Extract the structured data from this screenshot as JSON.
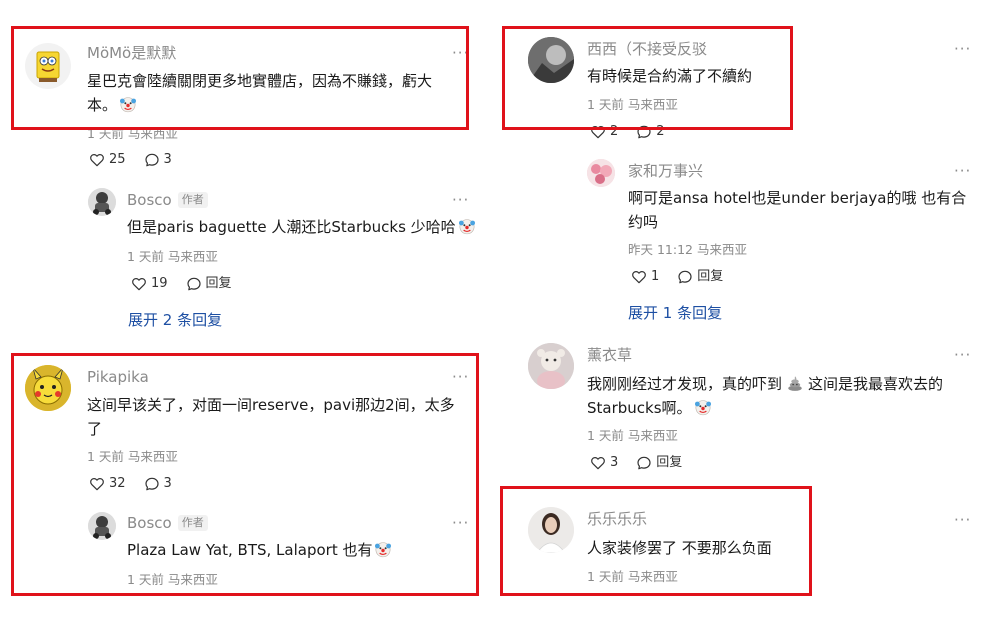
{
  "ui": {
    "more": "···",
    "author_tag": "作者",
    "highlight_color": "#e0121a",
    "link_color": "#1d4fa3"
  },
  "c1": {
    "user": "MöMö是默默",
    "text": "星巴克會陸續關閉更多地實體店，因為不賺錢，虧大本。",
    "emoji": "clown-face",
    "meta": "1 天前 马来西亚",
    "likes": "25",
    "comments": "3"
  },
  "r1": {
    "user": "Bosco",
    "text": "但是paris baguette 人潮还比Starbucks 少哈哈",
    "emoji": "clown-face",
    "meta": "1 天前 马来西亚",
    "likes": "19",
    "reply": "回复"
  },
  "expand1": "展开 2 条回复",
  "c2": {
    "user": "Pikapika",
    "text": "这间早该关了，对面一间reserve，pavi那边2间，太多了",
    "meta": "1 天前 马来西亚",
    "likes": "32",
    "comments": "3"
  },
  "r2": {
    "user": "Bosco",
    "text": "Plaza Law Yat, BTS, Lalaport 也有",
    "emoji": "clown-face",
    "meta": "1 天前 马来西亚"
  },
  "c3": {
    "user": "西西（不接受反驳",
    "text": "有時候是合約滿了不續約",
    "meta": "1 天前 马来西亚",
    "likes": "2",
    "comments": "2"
  },
  "r3": {
    "user": "家和万事兴",
    "text": "啊可是ansa hotel也是under berjaya的哦 也有合约吗",
    "meta": "昨天 11:12 马来西亚",
    "likes": "1",
    "reply": "回复"
  },
  "expand2": "展开 1 条回复",
  "c4": {
    "user": "薰衣草",
    "text_a": "我刚刚经过才发现，真的吓到",
    "emoji_a": "poop",
    "text_b": "这间是我最喜欢去的Starbucks啊。",
    "emoji_b": "clown-face",
    "meta": "1 天前 马来西亚",
    "likes": "3",
    "reply": "回复"
  },
  "c5": {
    "user": "乐乐乐乐",
    "text": "人家装修罢了 不要那么负面",
    "meta": "1 天前 马来西亚"
  }
}
